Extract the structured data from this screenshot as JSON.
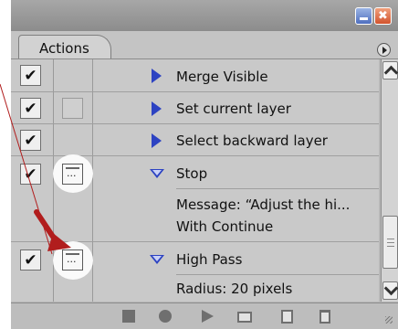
{
  "panel": {
    "tab_label": "Actions"
  },
  "rows": [
    {
      "label": "Merge Visible",
      "checked": true,
      "dialog": "none",
      "expander": "collapsed"
    },
    {
      "label": "Set current layer",
      "checked": true,
      "dialog": "empty",
      "expander": "collapsed"
    },
    {
      "label": "Select backward layer",
      "checked": true,
      "dialog": "none",
      "expander": "collapsed"
    },
    {
      "label": "Stop",
      "checked": true,
      "dialog": "on",
      "expander": "expanded"
    },
    {
      "label": "Message:  “Adjust the hi...",
      "detail": true
    },
    {
      "label": "With Continue",
      "detail": true
    },
    {
      "label": "High Pass",
      "checked": true,
      "dialog": "on",
      "expander": "expanded"
    },
    {
      "label": "Radius: 20 pixels",
      "detail": true
    }
  ],
  "check_glyph": "✔",
  "icons": {
    "minimize": "minimize-icon",
    "close": "close-icon",
    "panel_menu": "panel-menu-icon",
    "stop": "stop-icon",
    "record": "record-icon",
    "play": "play-icon",
    "new_set": "folder-icon",
    "new_action": "new-action-icon",
    "delete": "trash-icon"
  },
  "colors": {
    "annotation": "#b11d1d",
    "expander": "#2d43c2"
  },
  "window": {
    "close_glyph": "✖"
  }
}
